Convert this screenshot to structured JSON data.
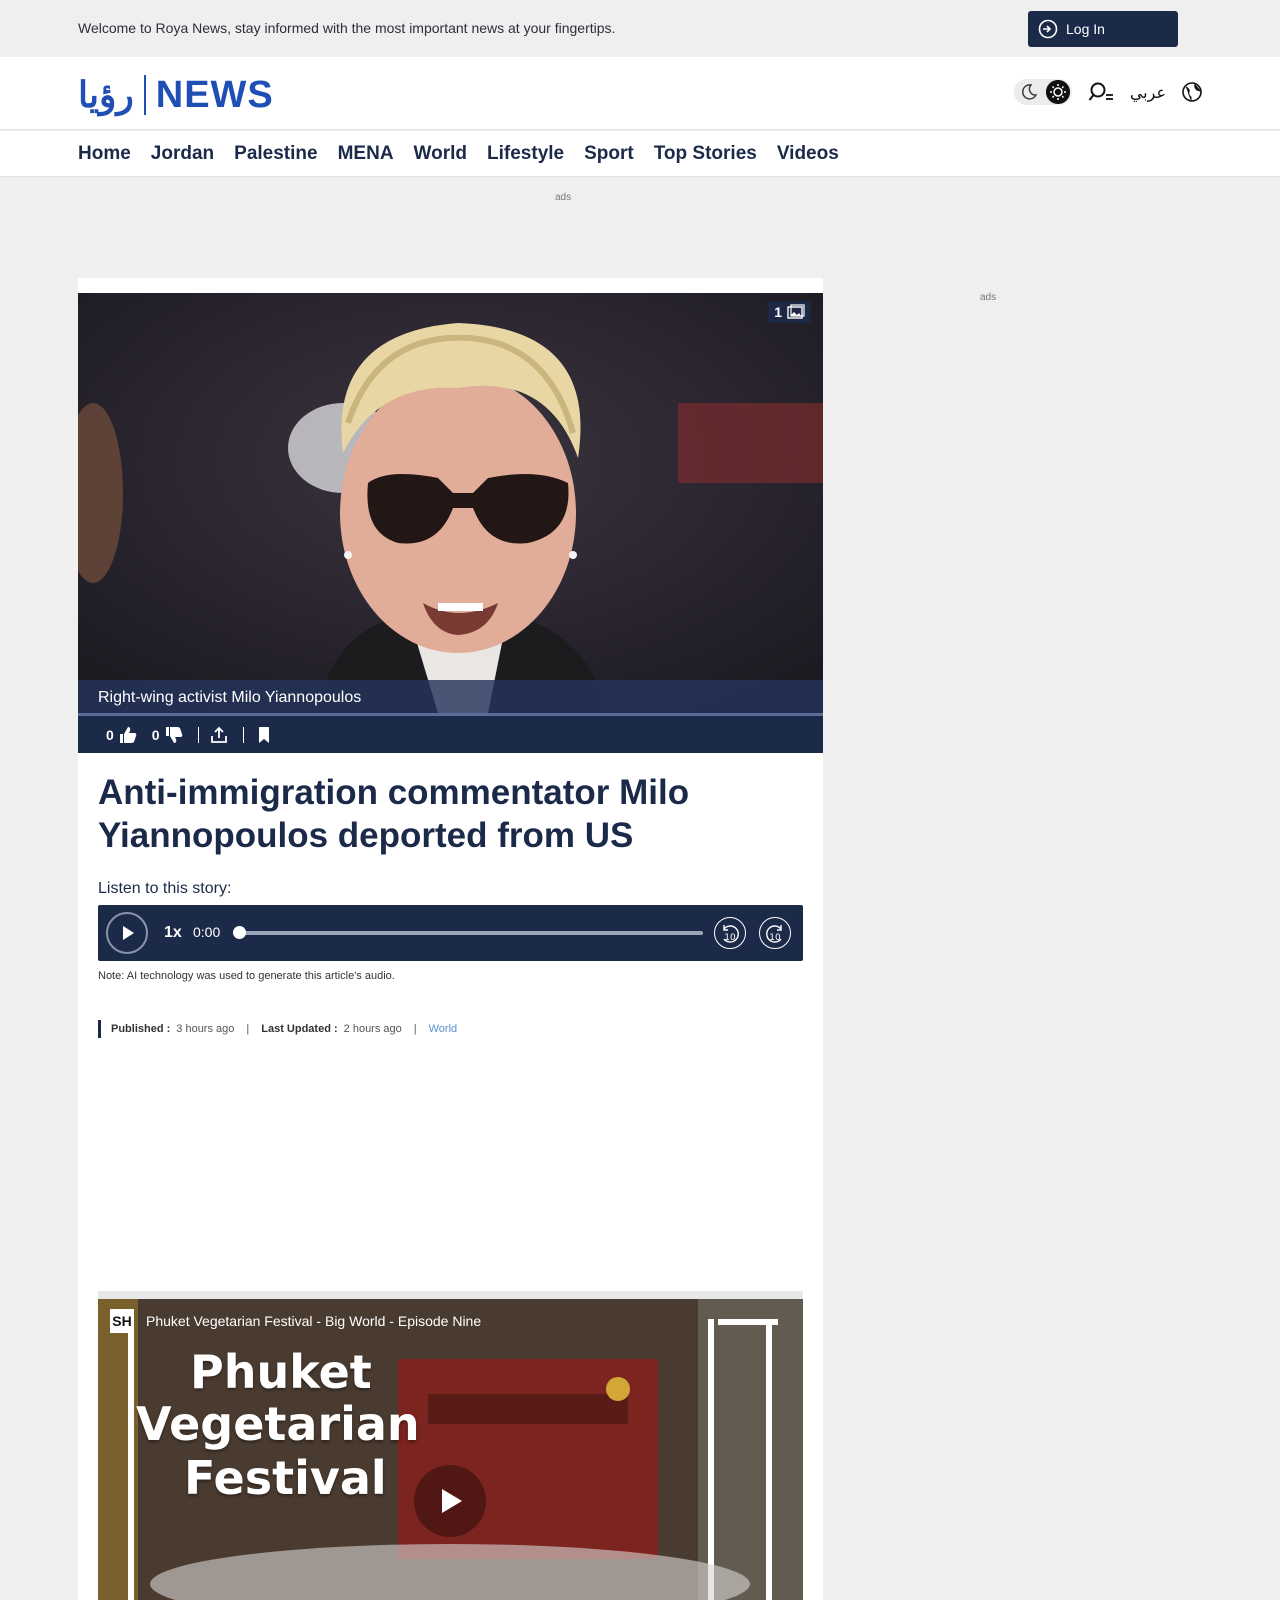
{
  "topbar": {
    "welcome": "Welcome to Roya News, stay informed with the most important news at your fingertips.",
    "login_label": "Log In"
  },
  "header": {
    "logo_ar": "رؤيا",
    "logo_en": "NEWS",
    "language_label": "عربي"
  },
  "nav": {
    "items": [
      "Home",
      "Jordan",
      "Palestine",
      "MENA",
      "World",
      "Lifestyle",
      "Sport",
      "Top Stories",
      "Videos"
    ]
  },
  "ads": {
    "top_label": "ads",
    "side_label": "ads"
  },
  "article": {
    "image_count": "1",
    "caption": "Right-wing activist Milo Yiannopoulos",
    "likes": "0",
    "dislikes": "0",
    "headline": "Anti-immigration commentator Milo Yiannopoulos deported from US",
    "listen_label": "Listen to this story:",
    "player": {
      "speed": "1x",
      "time": "0:00",
      "progress": 0
    },
    "ai_note": "Note: AI technology was used to generate this article's audio.",
    "meta": {
      "published_label": "Published :",
      "published_value": "3 hours ago",
      "updated_label": "Last Updated :",
      "updated_value": "2 hours ago",
      "category": "World"
    }
  },
  "video": {
    "channel_badge": "SH",
    "title": "Phuket Vegetarian Festival - Big World - Episode Nine",
    "overlay_line1": "Phuket",
    "overlay_line2": "Vegetarian",
    "overlay_line3": "Festival"
  },
  "colors": {
    "brand": "#1f4fb4",
    "navy": "#1c2a4a",
    "link": "#5a8fd0"
  }
}
